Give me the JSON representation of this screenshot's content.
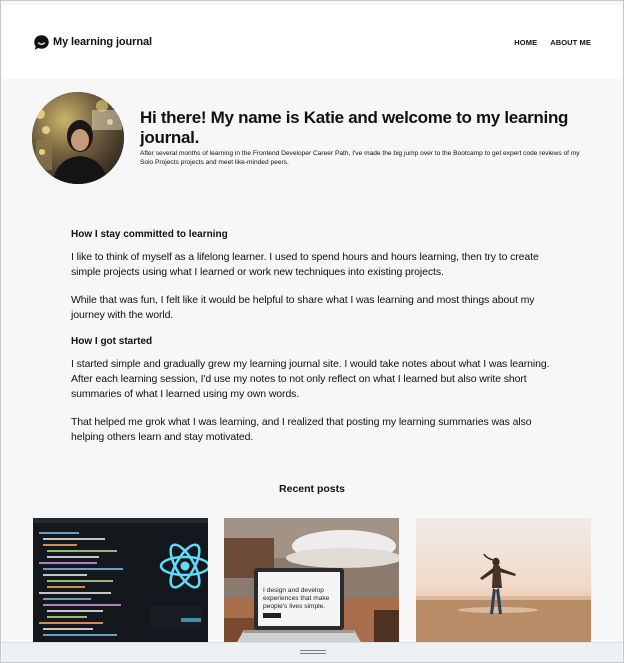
{
  "header": {
    "logo_icon": "chat-bubble-icon",
    "title": "My learning journal",
    "nav": [
      {
        "label": "HOME"
      },
      {
        "label": "ABOUT ME"
      }
    ]
  },
  "hero": {
    "heading": "Hi there! My name is Katie and welcome to my learning journal.",
    "text": "After several months of learning in the Frontend Developer Career Path, I've made the big jump over to the Bootcamp to get expert code reviews of my Solo Projects projects and meet like-minded peers."
  },
  "article": {
    "section1_title": "How I stay committed to learning",
    "section1_p1": "I like to think of myself as a lifelong learner. I used to spend hours and hours learning, then try to create simple projects using what I learned or work new techniques into existing projects.",
    "section1_p2": "While that was fun, I felt like it would be helpful to share what I was learning and most things about my journey with the world.",
    "section2_title": "How I got started",
    "section2_p1": "I started simple and gradually grew my learning journal site. I would take notes about what I was learning. After each learning session, I'd use my notes to not only reflect on what I learned but also write short summaries of what I learned using my own words.",
    "section2_p2": "That helped me grok what I was learning, and I realized that posting my learning summaries was also helping others learn and stay motivated."
  },
  "recent": {
    "title": "Recent posts",
    "posts": [
      {
        "image": "code-editor-react-logo"
      },
      {
        "image": "laptop-on-desk",
        "screen_line1": "I design and develop",
        "screen_line2": "experiences that make",
        "screen_line3": "people's lives simple."
      },
      {
        "image": "person-on-beach-sunset"
      }
    ]
  },
  "colors": {
    "page_bg": "#f7f7f7",
    "header_bg": "#ffffff",
    "text": "#111111",
    "react_blue": "#61dafb"
  }
}
